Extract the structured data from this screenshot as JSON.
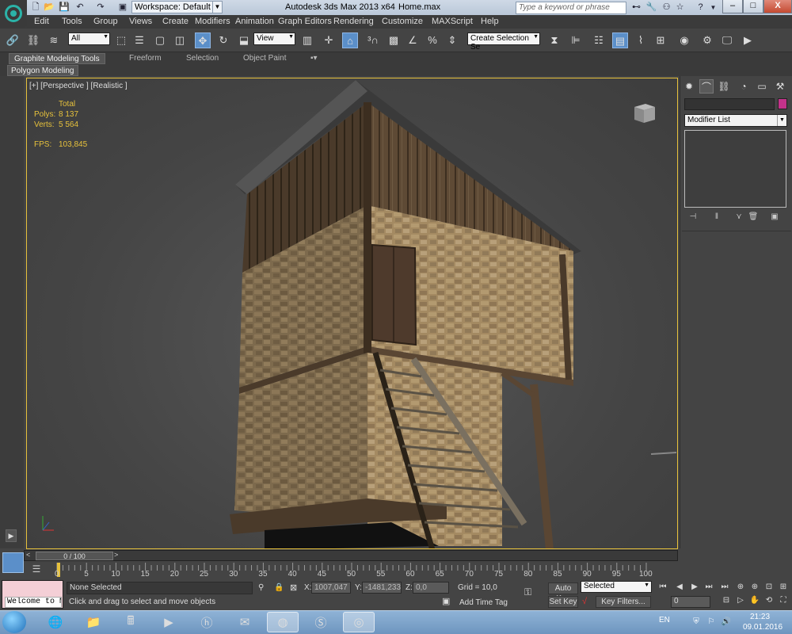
{
  "titlebar": {
    "app_title": "Autodesk 3ds Max  2013 x64",
    "file_name": "Home.max",
    "workspace": "Workspace: Default",
    "search_placeholder": "Type a keyword or phrase",
    "quick_access_icons": [
      "new-file-icon",
      "open-folder-icon",
      "save-icon",
      "undo-icon",
      "redo-icon",
      "project-folder-icon"
    ],
    "info_icons": [
      "binoculars-icon",
      "tools-icon",
      "star-icon",
      "help-icon"
    ],
    "window_buttons": {
      "minimize": "–",
      "maximize": "□",
      "close": "X"
    }
  },
  "menubar": [
    "Edit",
    "Tools",
    "Group",
    "Views",
    "Create",
    "Modifiers",
    "Animation",
    "Graph Editors",
    "Rendering",
    "Customize",
    "MAXScript",
    "Help"
  ],
  "main_toolbar": {
    "selection_filter": "All",
    "reference_coord": "View",
    "named_selection": "Create Selection Se"
  },
  "ribbon": {
    "tabs": [
      "Graphite Modeling Tools",
      "Freeform",
      "Selection",
      "Object Paint"
    ],
    "sub_tab": "Polygon Modeling"
  },
  "viewport": {
    "label": "[+] [Perspective ] [Realistic ]",
    "stats": {
      "header": "Total",
      "polys_label": "Polys:",
      "polys_value": "8 137",
      "verts_label": "Verts:",
      "verts_value": "5 564",
      "fps_label": "FPS:",
      "fps_value": "103,845"
    },
    "border_color": "#e6c13c"
  },
  "command_panel": {
    "modifier_list": "Modifier List",
    "object_color": "#c4328a"
  },
  "time_slider": {
    "position": "0 / 100",
    "ticks": [
      "0",
      "5",
      "10",
      "15",
      "20",
      "25",
      "30",
      "35",
      "40",
      "45",
      "50",
      "55",
      "60",
      "65",
      "70",
      "75",
      "80",
      "85",
      "90",
      "95",
      "100"
    ]
  },
  "statusbar": {
    "maxscript_text": "Welcome to M",
    "selection_status": "None Selected",
    "prompt": "Click and drag to select and move objects",
    "x_label": "X:",
    "x_value": "1007,047",
    "y_label": "Y:",
    "y_value": "-1481,233",
    "z_label": "Z:",
    "z_value": "0,0",
    "grid": "Grid = 10,0",
    "add_time_tag": "Add Time Tag",
    "auto_key": "Auto Key",
    "set_key": "Set Key",
    "key_mode": "Selected",
    "key_filters": "Key Filters...",
    "current_frame": "0"
  },
  "taskbar": {
    "language": "EN",
    "time": "21:23",
    "date": "09.01.2016",
    "apps": [
      "internet-explorer-icon",
      "file-explorer-icon",
      "calculator-icon",
      "media-player-icon",
      "hp-icon",
      "mail-icon",
      "chrome-icon",
      "skype-icon",
      "3dsmax-icon"
    ]
  }
}
